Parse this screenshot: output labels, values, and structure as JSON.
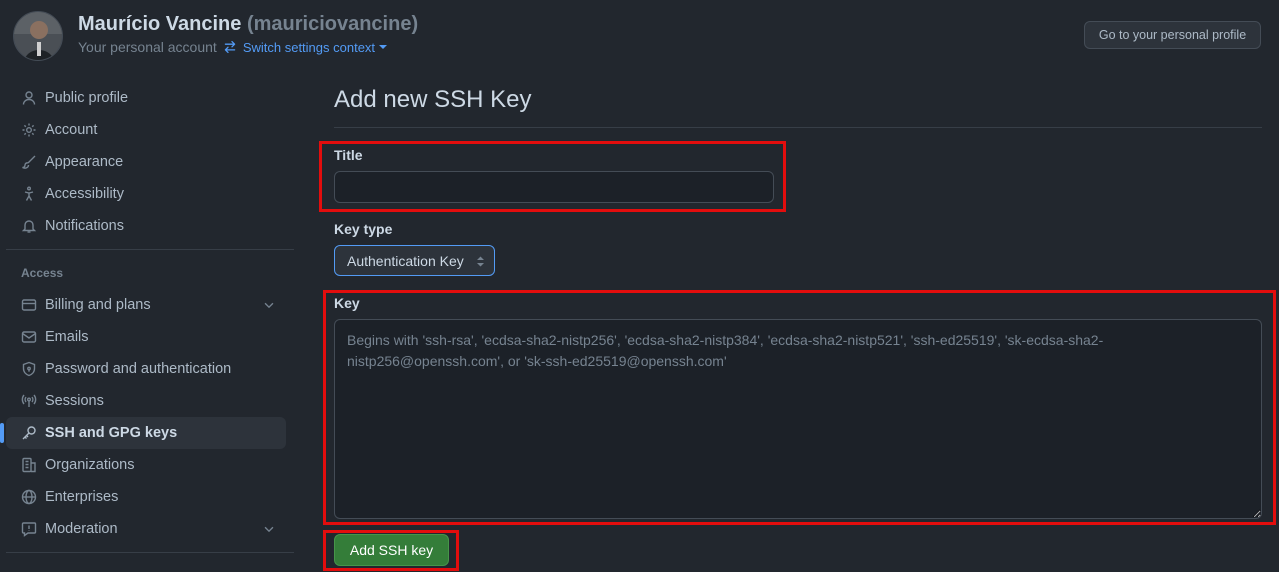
{
  "header": {
    "display_name": "Maurício Vancine",
    "login": "(mauriciovancine)",
    "account_label": "Your personal account",
    "switch_context": "Switch settings context",
    "profile_button": "Go to your personal profile"
  },
  "sidebar": {
    "items_top": [
      {
        "label": "Public profile",
        "icon": "person-icon"
      },
      {
        "label": "Account",
        "icon": "gear-icon"
      },
      {
        "label": "Appearance",
        "icon": "paintbrush-icon"
      },
      {
        "label": "Accessibility",
        "icon": "accessibility-icon"
      },
      {
        "label": "Notifications",
        "icon": "bell-icon"
      }
    ],
    "access_heading": "Access",
    "items_access": [
      {
        "label": "Billing and plans",
        "icon": "credit-card-icon",
        "expandable": true
      },
      {
        "label": "Emails",
        "icon": "mail-icon"
      },
      {
        "label": "Password and authentication",
        "icon": "shield-lock-icon"
      },
      {
        "label": "Sessions",
        "icon": "broadcast-icon"
      },
      {
        "label": "SSH and GPG keys",
        "icon": "key-icon",
        "active": true
      },
      {
        "label": "Organizations",
        "icon": "organization-icon"
      },
      {
        "label": "Enterprises",
        "icon": "globe-icon"
      },
      {
        "label": "Moderation",
        "icon": "report-icon",
        "expandable": true
      }
    ]
  },
  "main": {
    "title": "Add new SSH Key",
    "title_field_label": "Title",
    "title_field_value": "",
    "key_type_label": "Key type",
    "key_type_value": "Authentication Key",
    "key_label": "Key",
    "key_placeholder": "Begins with 'ssh-rsa', 'ecdsa-sha2-nistp256', 'ecdsa-sha2-nistp384', 'ecdsa-sha2-nistp521', 'ssh-ed25519', 'sk-ecdsa-sha2-nistp256@openssh.com', or 'sk-ssh-ed25519@openssh.com'",
    "submit_label": "Add SSH key"
  },
  "colors": {
    "background": "#22272e",
    "accent": "#539bf5",
    "primary_button": "#347d39",
    "highlight": "#e30d0d"
  }
}
